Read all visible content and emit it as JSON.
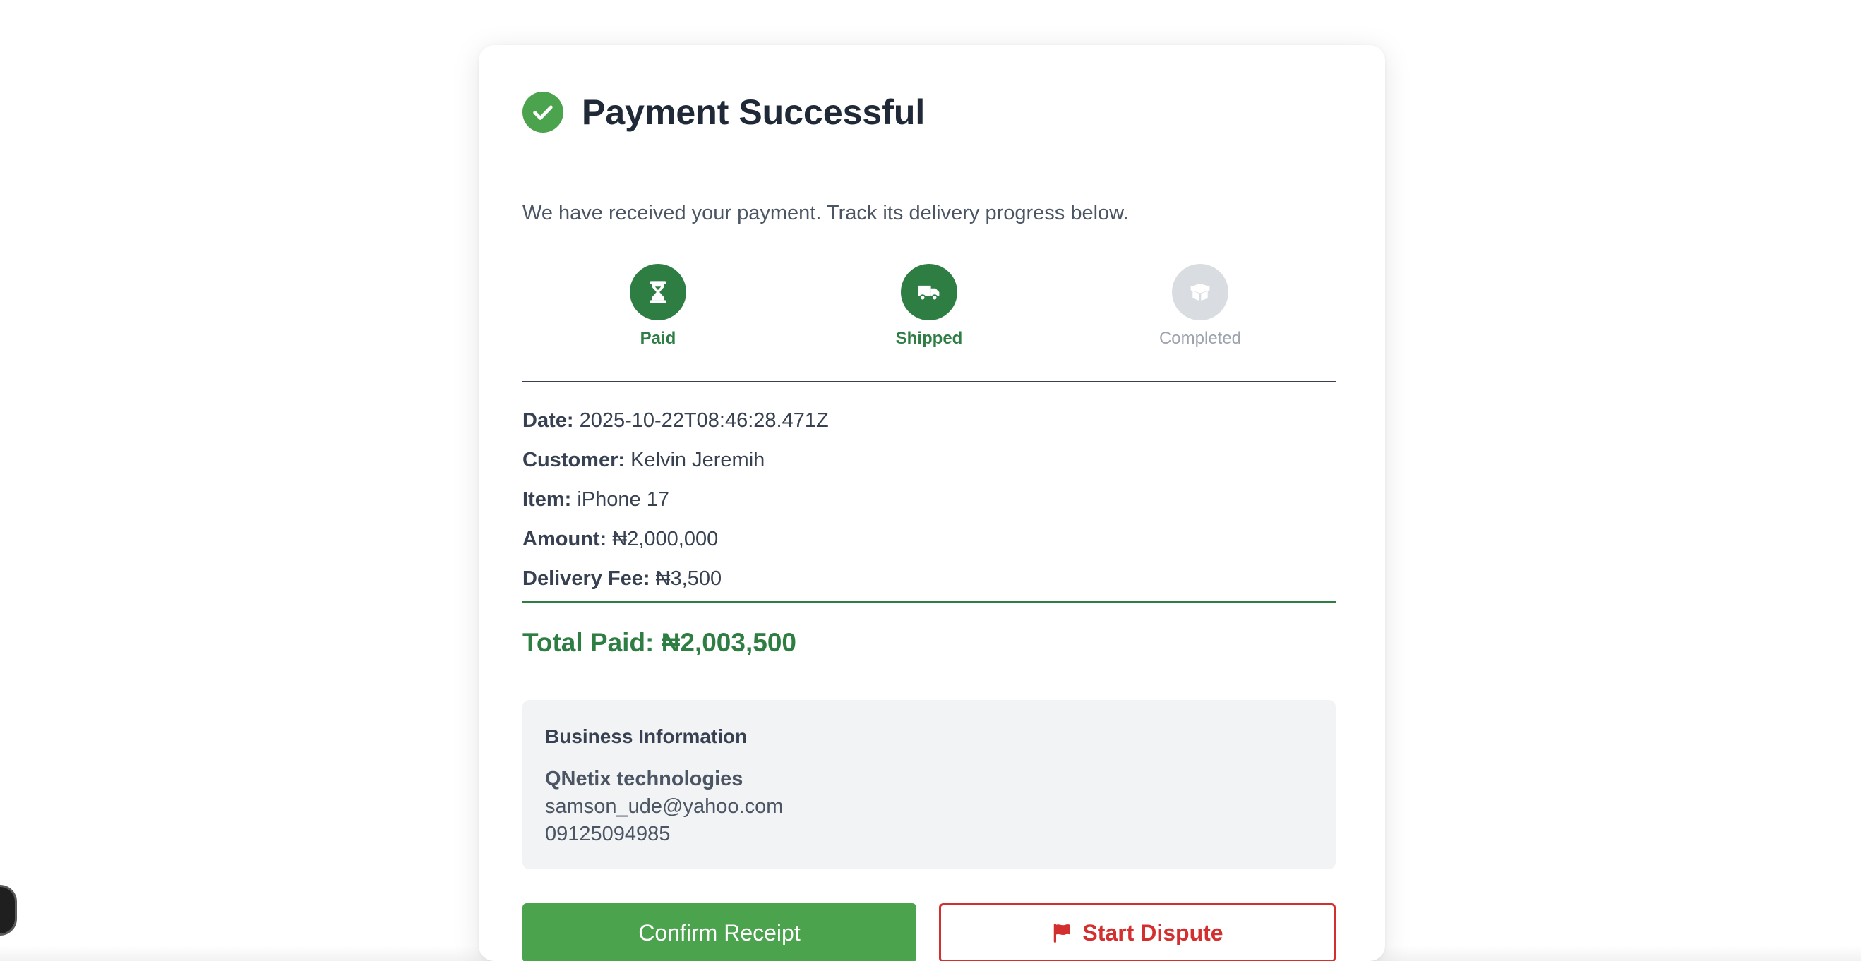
{
  "header": {
    "title": "Payment Successful",
    "subtitle": "We have received your payment. Track its delivery progress below."
  },
  "progress": {
    "steps": [
      {
        "label": "Paid",
        "icon": "hourglass-icon",
        "state": "active"
      },
      {
        "label": "Shipped",
        "icon": "truck-icon",
        "state": "active"
      },
      {
        "label": "Completed",
        "icon": "box-icon",
        "state": "inactive"
      }
    ]
  },
  "details": {
    "date_label": "Date:",
    "date_value": "2025-10-22T08:46:28.471Z",
    "customer_label": "Customer:",
    "customer_value": "Kelvin Jeremih",
    "item_label": "Item:",
    "item_value": "iPhone 17",
    "amount_label": "Amount:",
    "amount_value": "₦2,000,000",
    "fee_label": "Delivery Fee:",
    "fee_value": "₦3,500"
  },
  "total": {
    "text": "Total Paid: ₦2,003,500"
  },
  "business": {
    "heading": "Business Information",
    "name": "QNetix technologies",
    "email": "samson_ude@yahoo.com",
    "phone": "09125094985"
  },
  "actions": {
    "confirm_label": "Confirm Receipt",
    "dispute_label": "Start Dispute"
  },
  "colors": {
    "primary_green": "#4ba34d",
    "dark_green": "#2e7d43",
    "danger_red": "#d32f2f",
    "inactive_gray": "#d9dce1"
  }
}
